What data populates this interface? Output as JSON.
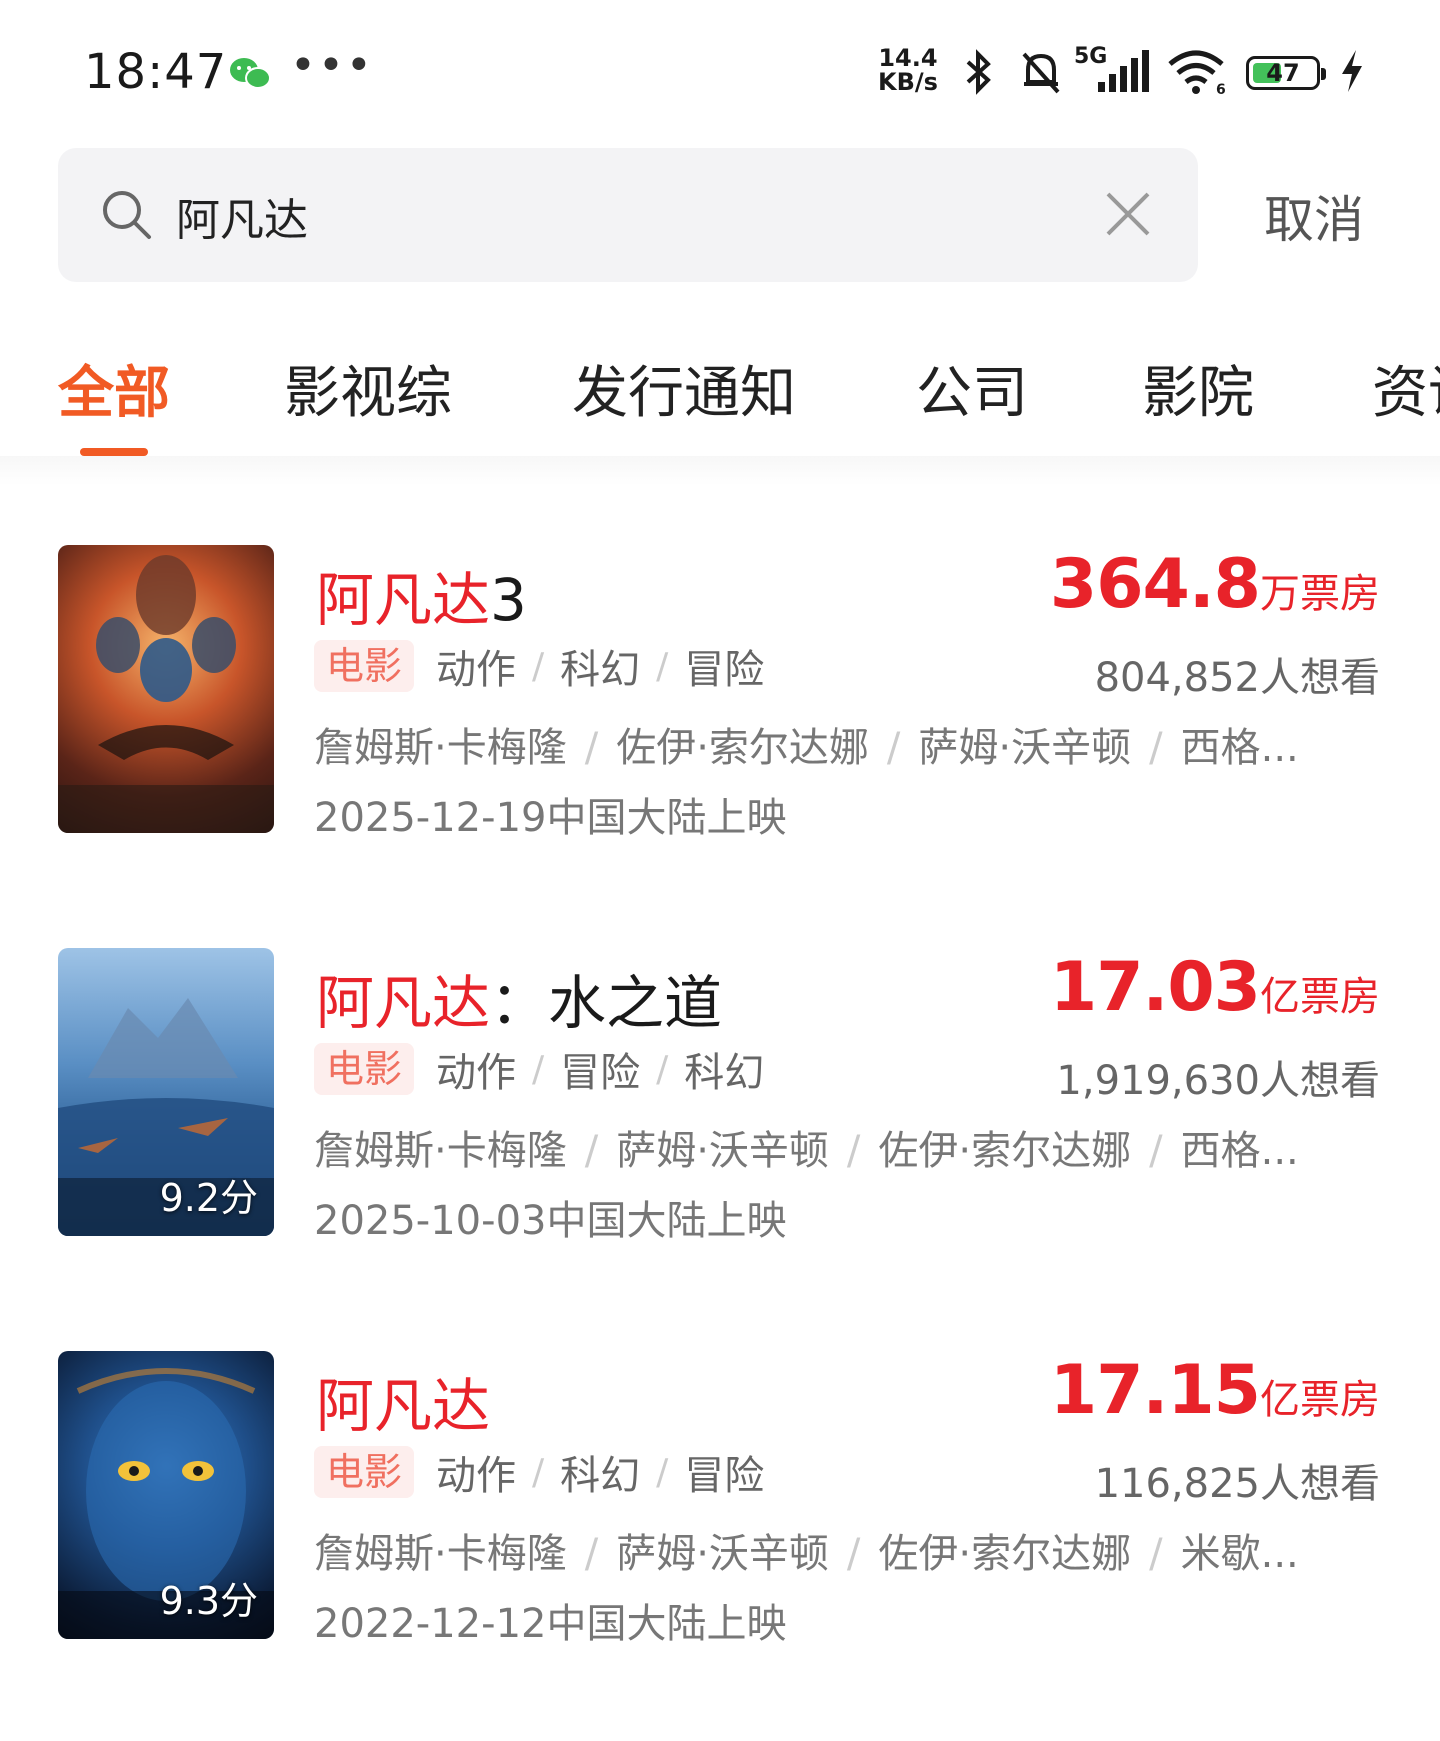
{
  "status_bar": {
    "time": "18:47",
    "net_speed_value": "14.4",
    "net_speed_unit": "KB/s",
    "network_type": "5G",
    "battery": "47",
    "battery_level": 0.47
  },
  "search": {
    "query": "阿凡达",
    "cancel_label": "取消"
  },
  "tabs": [
    "全部",
    "影视综",
    "发行通知",
    "公司",
    "影院",
    "资讯"
  ],
  "results": [
    {
      "title_highlight": "阿凡达",
      "title_rest": "3",
      "box_value": "364.8",
      "box_unit": "万票房",
      "type_badge": "电影",
      "genres": [
        "动作",
        "科幻",
        "冒险"
      ],
      "want_count": "804,852人想看",
      "cast": [
        "詹姆斯·卡梅隆",
        "佐伊·索尔达娜",
        "萨姆·沃辛顿",
        "西格..."
      ],
      "release": "2025-12-19中国大陆上映",
      "score": ""
    },
    {
      "title_highlight": "阿凡达",
      "title_rest": "：水之道",
      "box_value": "17.03",
      "box_unit": "亿票房",
      "type_badge": "电影",
      "genres": [
        "动作",
        "冒险",
        "科幻"
      ],
      "want_count": "1,919,630人想看",
      "cast": [
        "詹姆斯·卡梅隆",
        "萨姆·沃辛顿",
        "佐伊·索尔达娜",
        "西格..."
      ],
      "release": "2025-10-03中国大陆上映",
      "score": "9.2分"
    },
    {
      "title_highlight": "阿凡达",
      "title_rest": "",
      "box_value": "17.15",
      "box_unit": "亿票房",
      "type_badge": "电影",
      "genres": [
        "动作",
        "科幻",
        "冒险"
      ],
      "want_count": "116,825人想看",
      "cast": [
        "詹姆斯·卡梅隆",
        "萨姆·沃辛顿",
        "佐伊·索尔达娜",
        "米歇..."
      ],
      "release": "2022-12-12中国大陆上映",
      "score": "9.3分"
    }
  ],
  "colors": {
    "accent": "#f15a24",
    "highlight_red": "#e8232a",
    "battery_green": "#43c15a"
  }
}
